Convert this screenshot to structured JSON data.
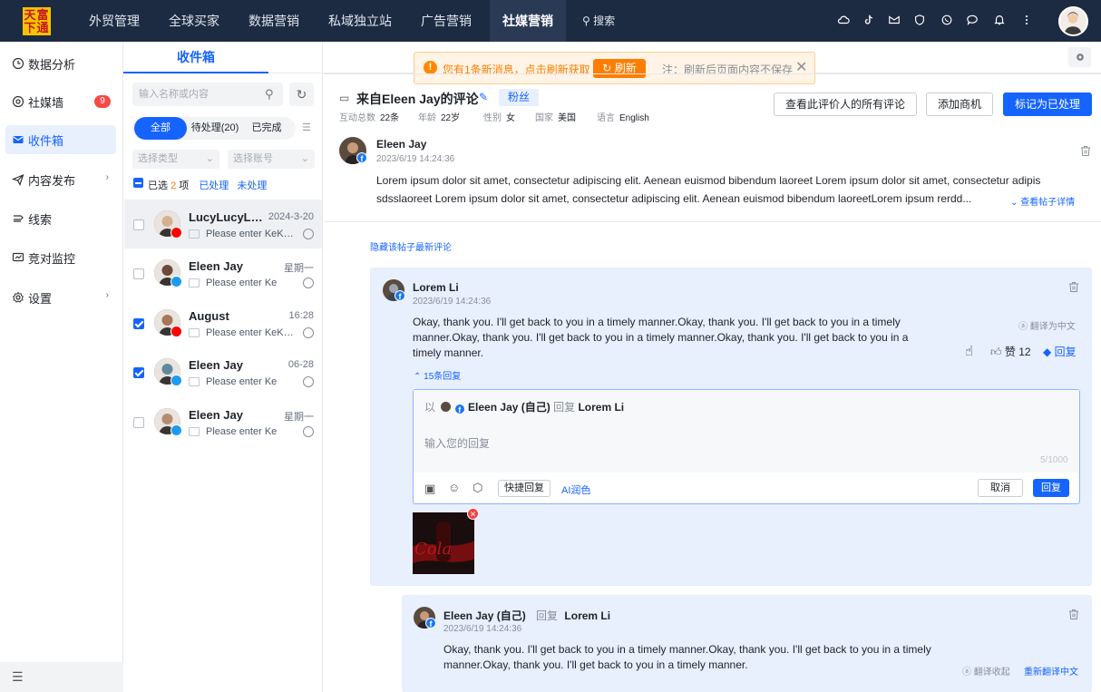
{
  "nav": {
    "logo": "天富下通",
    "items": [
      "外贸管理",
      "全球买家",
      "数据营销",
      "私域独立站",
      "广告营销",
      "社媒营销"
    ],
    "search": "搜索"
  },
  "sidebar": {
    "items": [
      {
        "label": "数据分析",
        "icon": "clock-icon"
      },
      {
        "label": "社媒墙",
        "icon": "target-icon",
        "badge": "9"
      },
      {
        "label": "收件箱",
        "icon": "mail-icon"
      },
      {
        "label": "内容发布",
        "icon": "send-icon"
      },
      {
        "label": "线索",
        "icon": "leads-icon"
      },
      {
        "label": "竞对监控",
        "icon": "monitor-icon"
      },
      {
        "label": "设置",
        "icon": "gear-icon"
      }
    ]
  },
  "inbox": {
    "tab": "收件箱",
    "search_placeholder": "输入名称或内容",
    "filters": [
      "全部",
      "待处理(20)",
      "已完成"
    ],
    "type_select": "选择类型",
    "account_select": "选择账号",
    "selected_prefix": "已选",
    "selected_count": "2",
    "selected_suffix": "项",
    "processed": "已处理",
    "unprocessed": "未处理",
    "items": [
      {
        "name": "LucyLucyLucy",
        "date": "2024-3-20",
        "msg": "Please enter KeKeKe",
        "platform": "youtube",
        "checked": false
      },
      {
        "name": "Eleen Jay",
        "date": "星期一",
        "msg": "Please enter Ke",
        "platform": "twitter",
        "checked": false
      },
      {
        "name": "August",
        "date": "16:28",
        "msg": "Please enter KeKeKe",
        "platform": "youtube",
        "checked": true
      },
      {
        "name": "Eleen Jay",
        "date": "06-28",
        "msg": "Please enter Ke",
        "platform": "twitter",
        "checked": true
      },
      {
        "name": "Eleen Jay",
        "date": "星期一",
        "msg": "Please enter Ke",
        "platform": "twitter",
        "checked": false
      }
    ]
  },
  "notice": {
    "text": "您有1条新消息，点击刷新获取",
    "refresh": "刷新",
    "note": "注：刷新后页面内容不保存"
  },
  "detail": {
    "title": "来自Eleen Jay的评论",
    "tag": "粉丝",
    "meta": [
      {
        "label": "互动总数",
        "value": "22条"
      },
      {
        "label": "年龄",
        "value": "22岁"
      },
      {
        "label": "性别",
        "value": "女"
      },
      {
        "label": "国家",
        "value": "美国"
      },
      {
        "label": "语言",
        "value": "English"
      }
    ],
    "btn_all_comments": "查看此评价人的所有评论",
    "btn_add_merchant": "添加商机",
    "btn_mark_done": "标记为已处理",
    "post": {
      "author": "Eleen Jay",
      "time": "2023/6/19  14:24:36",
      "line1": "Lorem ipsum dolor sit amet, consectetur adipiscing elit. Aenean euismod bibendum laoreet Lorem ipsum dolor sit amet, consectetur adipis",
      "line2": "sdsslaoreet Lorem ipsum dolor sit amet, consectetur adipiscing elit. Aenean euismod bibendum laoreetLorem ipsum rerdd...",
      "view_post": "查看帖子详情"
    },
    "hide_latest": "隐藏该帖子最新评论",
    "comment": {
      "author": "Lorem Li",
      "time": "2023/6/19  14:24:36",
      "text": "Okay, thank you. I'll get back to you in a timely manner.Okay, thank you. I'll get back to you in a timely manner.Okay, thank you. I'll get back to you in a timely manner.Okay, thank you. I'll get back to you in a timely manner.",
      "translate": "翻译为中文",
      "likes": "赞 12",
      "reply": "回复",
      "replies_toggle": "15条回复"
    },
    "reply_box": {
      "prefix": "以",
      "identity": "Eleen Jay (自己)",
      "reply_word": "回复",
      "target": "Lorem Li",
      "placeholder": "输入您的回复",
      "counter": "5/1000",
      "quick_reply": "快捷回复",
      "ai_polish": "AI润色",
      "cancel": "取消",
      "submit": "回复"
    },
    "sub_reply": {
      "author": "Eleen Jay (自己)",
      "reply_word": "回复",
      "target": "Lorem Li",
      "time": "2023/6/19  14:24:36",
      "text": "Okay, thank you. I'll get back to you in a timely manner.Okay, thank you. I'll get back to you in a timely manner.Okay, thank you. I'll get back to you in a timely manner.",
      "collapse_translation": "翻译收起",
      "retranslate": "重新翻译中文"
    }
  }
}
